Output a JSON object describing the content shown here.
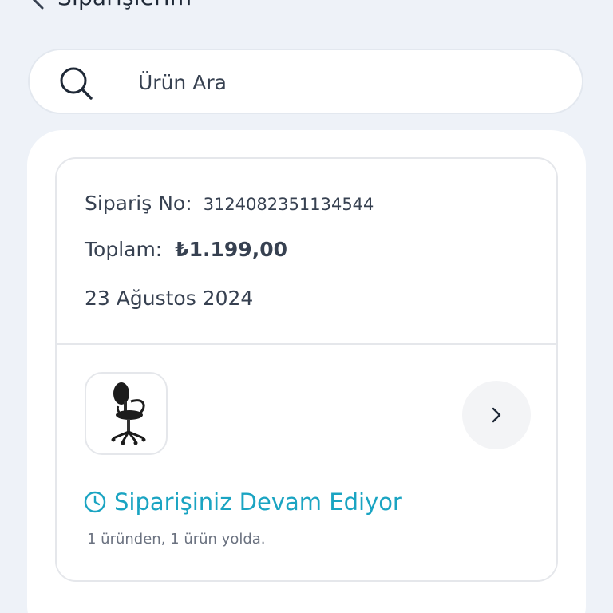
{
  "header": {
    "title": "Siparişlerim"
  },
  "search": {
    "placeholder": "Ürün Ara"
  },
  "order": {
    "order_no_label": "Sipariş No:",
    "order_no": "3124082351134544",
    "total_label": "Toplam:",
    "total": "₺1.199,00",
    "date": "23 Ağustos 2024",
    "product_icon": "office-chair",
    "status_icon": "clock-icon",
    "status": "Siparişiniz Devam Ediyor",
    "status_detail": "1 üründen, 1 ürün yolda.",
    "status_color": "#1aa4c2"
  }
}
